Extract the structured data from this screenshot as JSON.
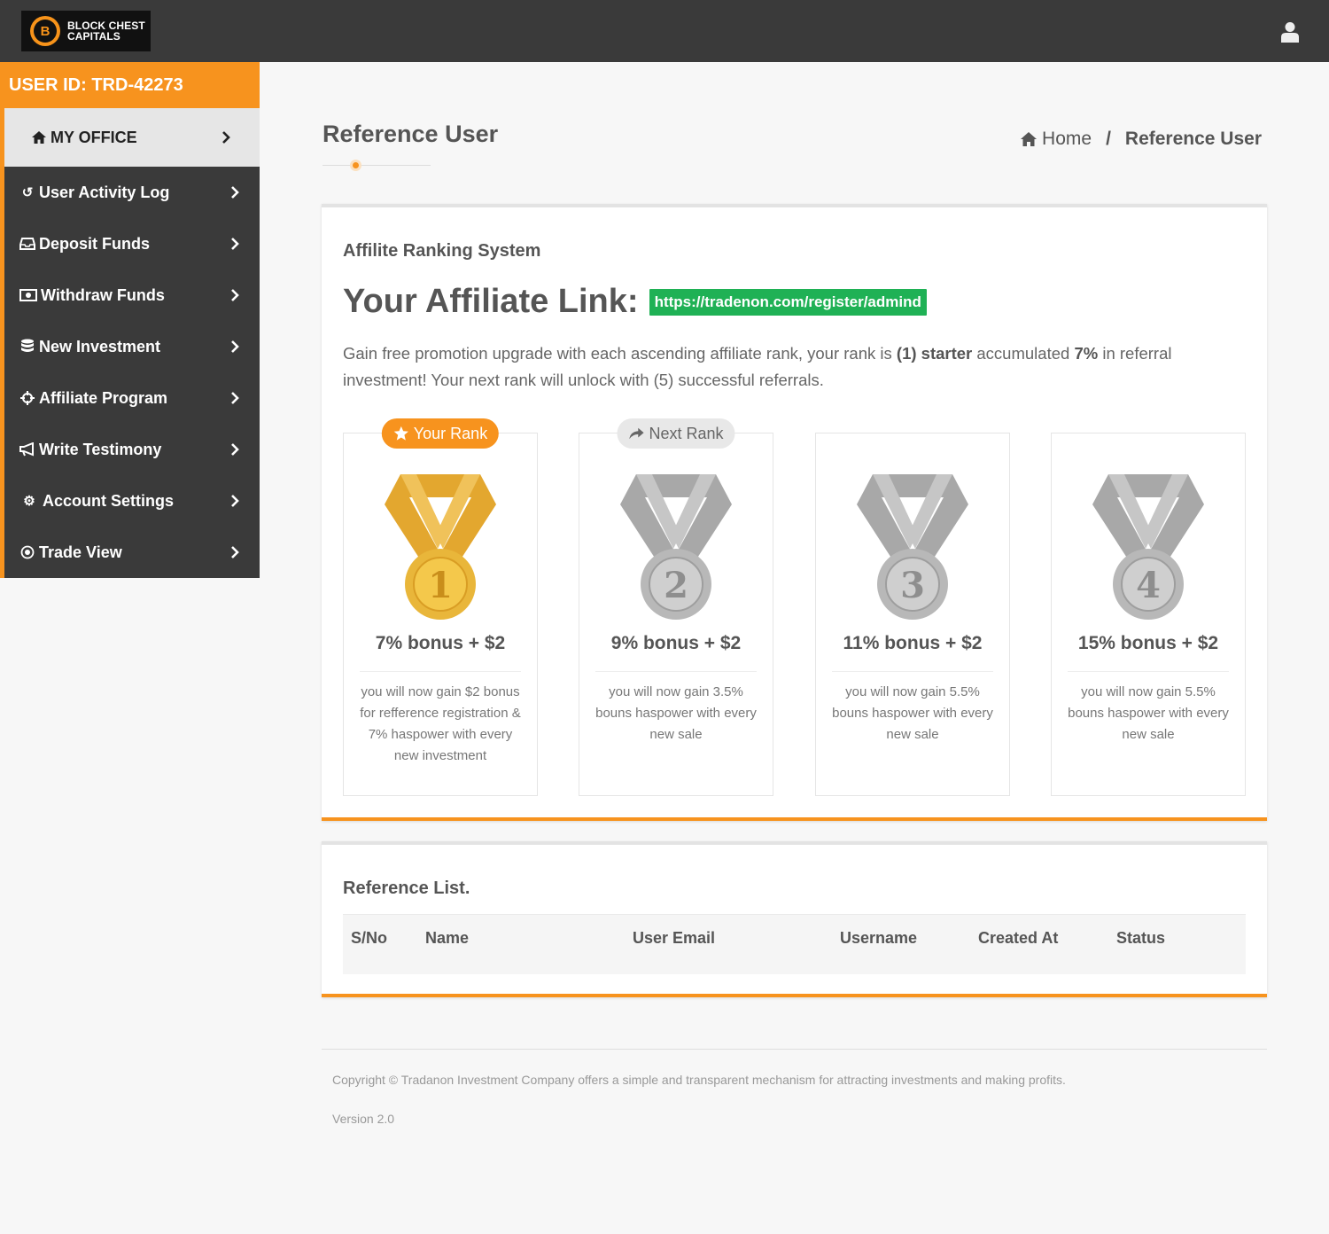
{
  "brand": {
    "line1": "BLOCK CHEST",
    "line2": "CAPITALS",
    "coin": "B"
  },
  "sidebar": {
    "user_id": "USER ID: TRD-42273",
    "office": {
      "label": "MY OFFICE",
      "icon": "home-icon"
    },
    "items": [
      {
        "label": "User Activity Log",
        "icon": "history-icon"
      },
      {
        "label": "Deposit Funds",
        "icon": "inbox-icon"
      },
      {
        "label": "Withdraw Funds",
        "icon": "money-icon"
      },
      {
        "label": "New Investment",
        "icon": "database-icon"
      },
      {
        "label": "Affiliate Program",
        "icon": "crosshairs-icon"
      },
      {
        "label": "Write Testimony",
        "icon": "bullhorn-icon"
      },
      {
        "label": "Account Settings",
        "icon": "gears-icon"
      },
      {
        "label": "Trade View",
        "icon": "target-icon"
      }
    ]
  },
  "page": {
    "title": "Reference User",
    "breadcrumb": {
      "home": "Home",
      "separator": "/",
      "current": "Reference User"
    }
  },
  "affiliate": {
    "heading": "Affilite Ranking System",
    "link_label": "Your Affiliate Link:",
    "link": "https://tradenon.com/register/admind",
    "desc_1": "Gain free promotion upgrade with each ascending affiliate rank, your rank is ",
    "desc_rank": "(1) starter",
    "desc_2": " accumulated ",
    "desc_pct": "7%",
    "desc_3": " in referral investment! Your next rank will unlock with (5) successful referrals.",
    "ranks": [
      {
        "badge": "Your Rank",
        "number": "1",
        "bonus": "7% bonus + $2",
        "text": "you will now gain $2 bonus for refference registration & 7% haspower with every new investment"
      },
      {
        "badge": "Next Rank",
        "number": "2",
        "bonus": "9% bonus + $2",
        "text": "you will now gain 3.5% bouns haspower with every new sale"
      },
      {
        "badge": "",
        "number": "3",
        "bonus": "11% bonus + $2",
        "text": "you will now gain 5.5% bouns haspower with every new sale"
      },
      {
        "badge": "",
        "number": "4",
        "bonus": "15% bonus + $2",
        "text": "you will now gain 5.5% bouns haspower with every new sale"
      }
    ]
  },
  "reference_list": {
    "heading": "Reference List.",
    "columns": [
      "S/No",
      "Name",
      "User Email",
      "Username",
      "Created At",
      "Status"
    ]
  },
  "footer": {
    "copyright": "Copyright © Tradanon Investment Company offers a simple and transparent mechanism for attracting investments and making profits.",
    "version": "Version 2.0"
  },
  "colors": {
    "accent": "#f7931e",
    "link_bg": "#1fb155",
    "gold": "#e9b63a",
    "silver": "#b8b8b8"
  }
}
